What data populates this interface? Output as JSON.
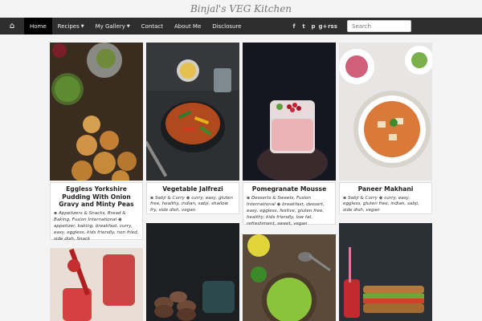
{
  "site": {
    "logo": "Binjal's VEG Kitchen"
  },
  "nav": {
    "home_icon": "⌂",
    "items": [
      {
        "label": "Home"
      },
      {
        "label": "Recipes"
      },
      {
        "label": "My Gallery"
      },
      {
        "label": "Contact"
      },
      {
        "label": "About Me"
      },
      {
        "label": "Disclosure"
      }
    ],
    "social": [
      "f",
      "t",
      "p",
      "g+",
      "rss"
    ],
    "search_placeholder": "Search"
  },
  "posts": [
    {
      "title": "Eggless Yorkshire Pudding With Onion Gravy and Minty Peas",
      "categories": "Appetizers & Snacks, Bread & Baking, Fusion International",
      "tags": "appetizer, baking, breakfast, curry, easy, eggless, kids friendly, non fried, side dish, Snack"
    },
    {
      "title": "Vegetable Jalfrezi",
      "categories": "Sabji & Curry",
      "tags": "curry, easy, gluten free, healthy, indian, sabji, shallow fry, side dish, vegan"
    },
    {
      "title": "Pomegranate Mousse",
      "categories": "Desserts & Sweets, Fusion International",
      "tags": "breakfast, dessert, easy, eggless, festive, gluten free, healthy, kids friendly, low fat, refreshment, sweet, vegan"
    },
    {
      "title": "Paneer Makhani",
      "categories": "Sabji & Curry",
      "tags": "curry, easy, eggless, gluten free, indian, sabji, side dish, vegan"
    }
  ],
  "colors": {
    "nav_bg": "#2e2e2e",
    "active_bg": "#000000",
    "page_bg": "#f4f4f4"
  }
}
